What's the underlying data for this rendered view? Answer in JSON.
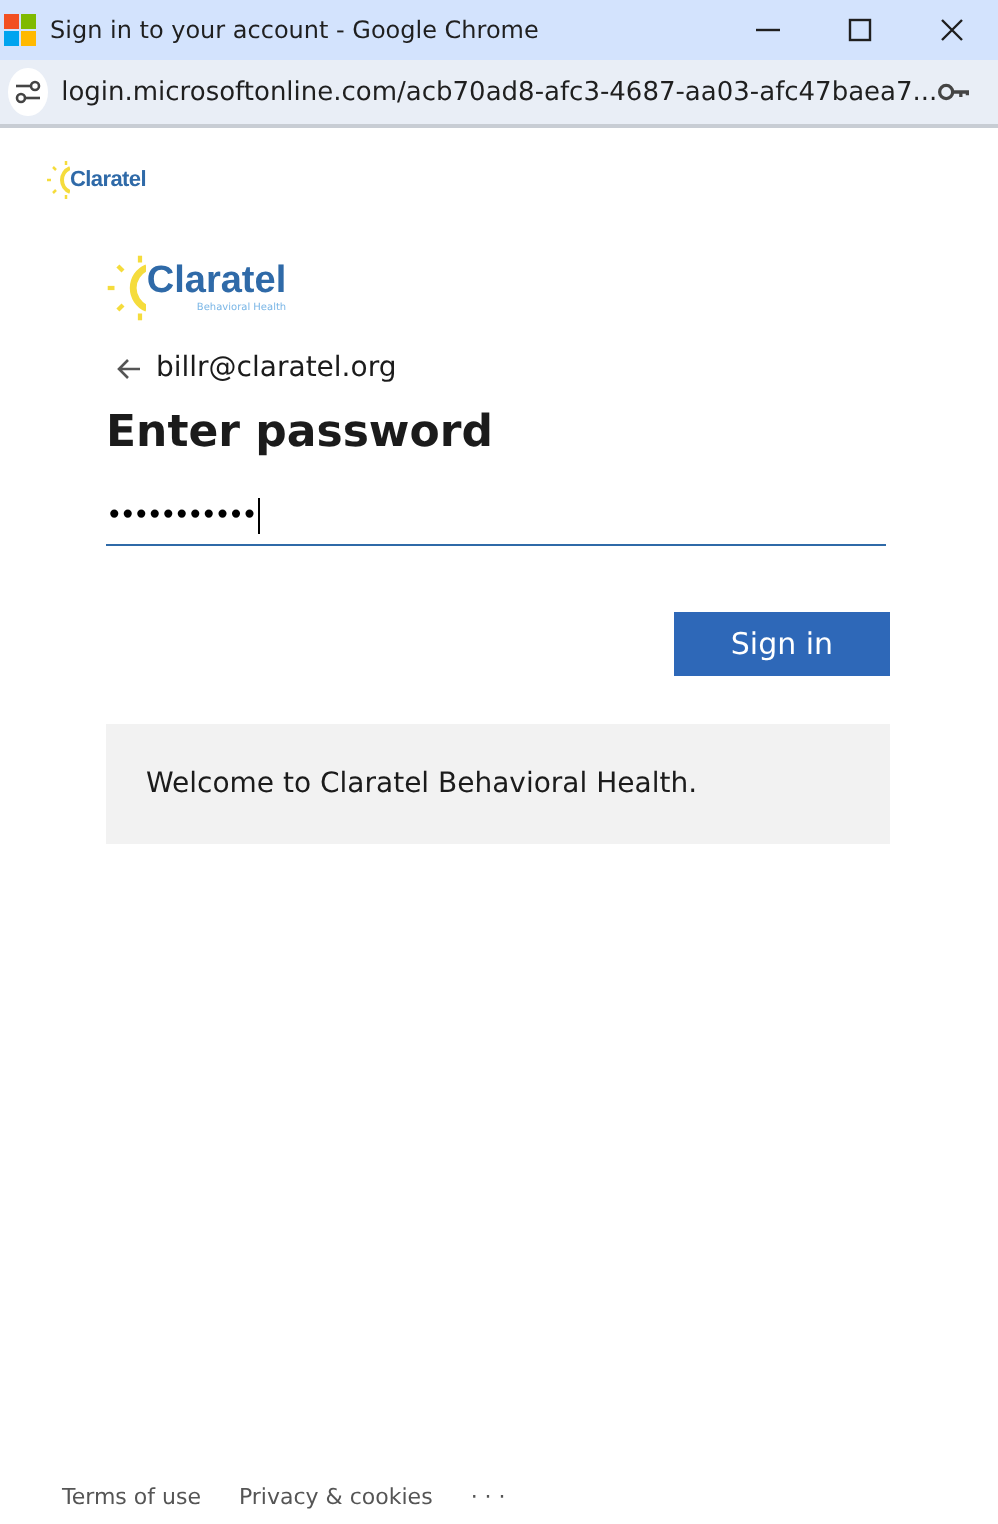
{
  "window": {
    "title": "Sign in to your account - Google Chrome"
  },
  "address_bar": {
    "url": "login.microsoftonline.com/acb70ad8-afc3-4687-aa03-afc47baea7..."
  },
  "header": {
    "logo": "Claratel"
  },
  "card": {
    "logo": "Claratel",
    "logo_tagline": "Behavioral Health",
    "account": "billr@claratel.org",
    "heading": "Enter password",
    "password": {
      "value": "•••••••••••",
      "focused": true
    },
    "button": "Sign in",
    "message": "Welcome to Claratel Behavioral Health."
  },
  "footer": {
    "links": [
      "Terms of use",
      "Privacy & cookies"
    ],
    "more": "· · ·"
  }
}
